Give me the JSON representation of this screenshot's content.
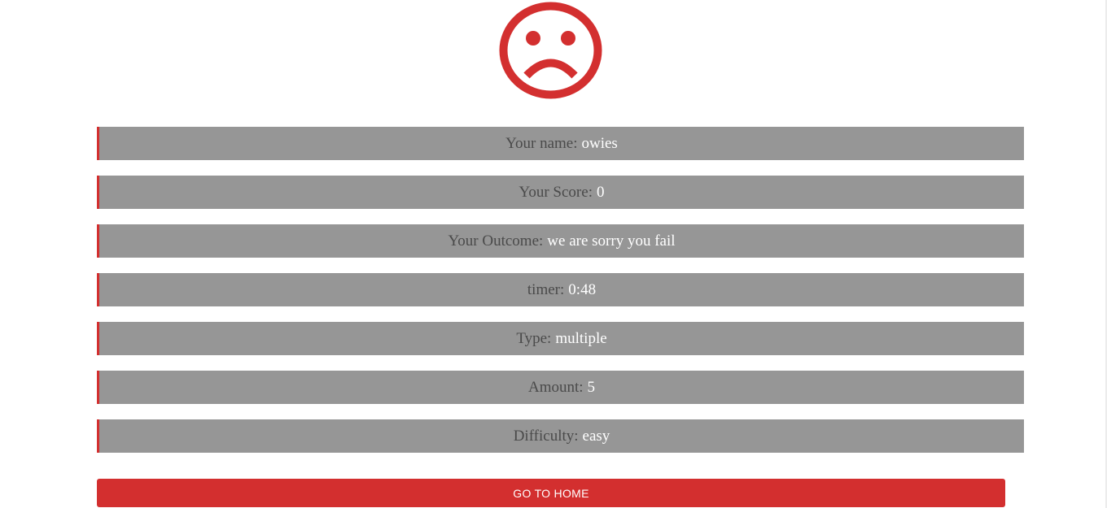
{
  "result": {
    "icon": "sad-face-icon",
    "accent_color": "#d32f2f",
    "row_background": "#969696",
    "rows": [
      {
        "label": "Your name:",
        "value": "owies"
      },
      {
        "label": "Your Score:",
        "value": "0"
      },
      {
        "label": "Your Outcome:",
        "value": "we are sorry you fail"
      },
      {
        "label": "timer:",
        "value": "0:48"
      },
      {
        "label": "Type:",
        "value": "multiple"
      },
      {
        "label": "Amount:",
        "value": "5"
      },
      {
        "label": "Difficulty:",
        "value": "easy"
      }
    ]
  },
  "actions": {
    "home_label": "GO TO HOME"
  }
}
